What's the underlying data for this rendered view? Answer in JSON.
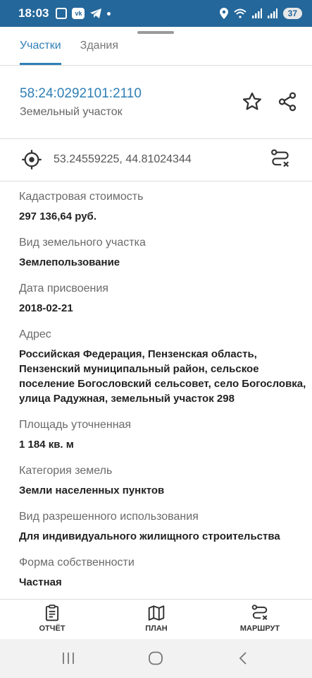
{
  "status_bar": {
    "time": "18:03",
    "battery": "37",
    "colors": {
      "background": "#24679a"
    },
    "icons": [
      "screenshot-icon",
      "vk-icon",
      "telegram-icon",
      "location-icon",
      "wifi-icon",
      "signal-icon",
      "battery-icon"
    ]
  },
  "tabs": [
    {
      "label": "Участки",
      "active": true
    },
    {
      "label": "Здания",
      "active": false
    }
  ],
  "object": {
    "cadastral_number": "58:24:0292101:2110",
    "type": "Земельный участок",
    "coordinates": "53.24559225, 44.81024344"
  },
  "fields": [
    {
      "label": "Кадастровая стоимость",
      "value": "297 136,64 руб."
    },
    {
      "label": "Вид земельного участка",
      "value": "Землепользование"
    },
    {
      "label": "Дата присвоения",
      "value": "2018-02-21"
    },
    {
      "label": "Адрес",
      "value": "Российская Федерация, Пензенская область, Пензенский муниципальный район, сельское поселение Богословский сельсовет, село Богословка, улица Радужная, земельный участок 298"
    },
    {
      "label": "Площадь уточненная",
      "value": "1 184 кв. м"
    },
    {
      "label": "Категория земель",
      "value": "Земли населенных пунктов"
    },
    {
      "label": "Вид разрешенного использования",
      "value": "Для индивидуального жилищного строительства"
    },
    {
      "label": "Форма собственности",
      "value": "Частная"
    }
  ],
  "bottom_nav": {
    "report": "ОТЧЁТ",
    "plan": "ПЛАН",
    "route": "МАРШРУТ"
  },
  "theme": {
    "accent": "#2f7fb6",
    "divider": "#dcdcdc"
  }
}
